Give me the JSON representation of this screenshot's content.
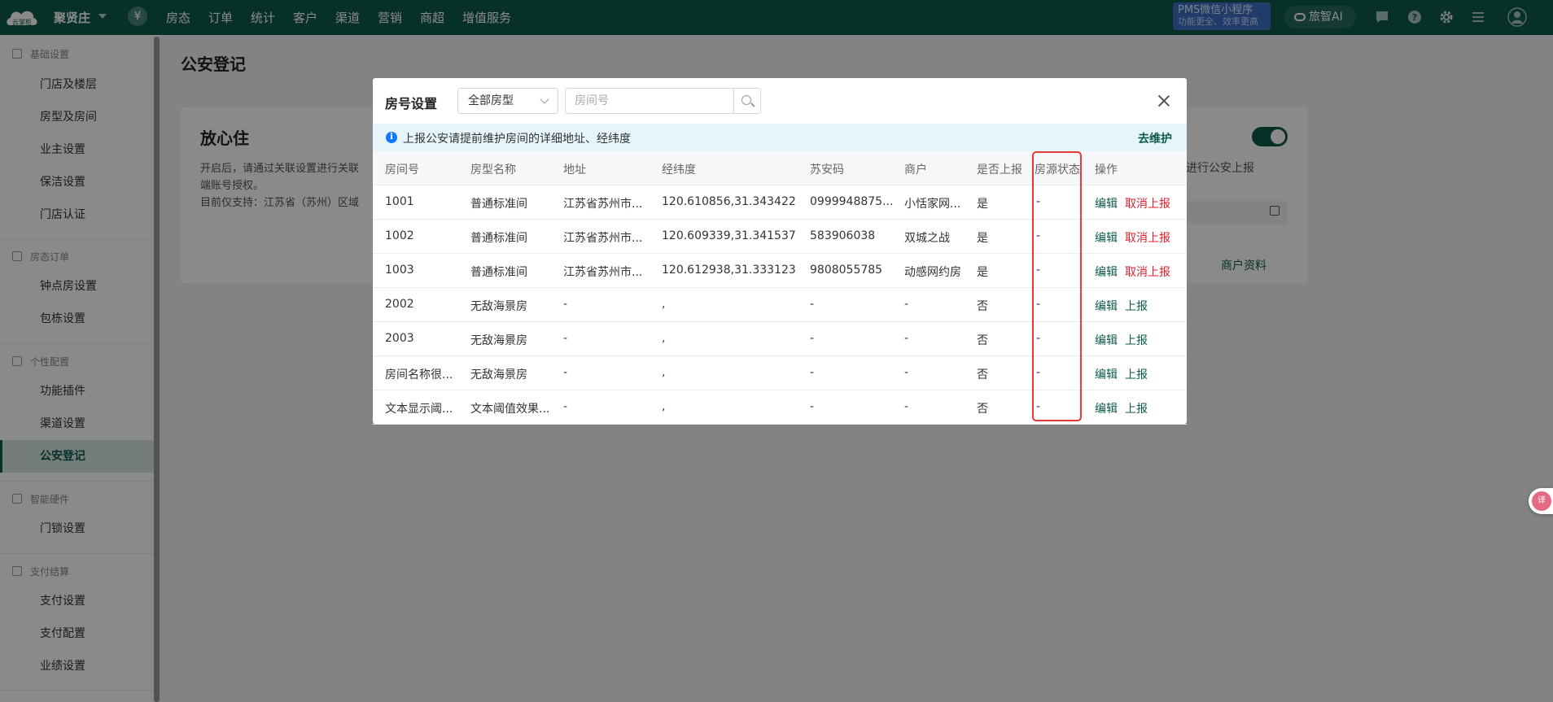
{
  "topbar": {
    "logo_text": "云掌柜",
    "store_name": "聚贤庄",
    "currency_icon": "¥",
    "nav": [
      "房态",
      "订单",
      "统计",
      "客户",
      "渠道",
      "营销",
      "商超",
      "增值服务"
    ],
    "pms_line1": "PMS微信小程序",
    "pms_line2": "功能更全、效率更高",
    "ai_label": "旅智AI",
    "colors": {
      "bar": "#0d5a4b",
      "pms": "#3e6fc4"
    }
  },
  "sidebar": {
    "groups": [
      {
        "label": "基础设置",
        "icon": "home-icon",
        "items": [
          "门店及楼层",
          "房型及房间",
          "业主设置",
          "保洁设置",
          "门店认证"
        ]
      },
      {
        "label": "房态订单",
        "icon": "calendar-icon",
        "items": [
          "钟点房设置",
          "包栋设置"
        ]
      },
      {
        "label": "个性配置",
        "icon": "config-icon",
        "items": [
          "功能插件",
          "渠道设置",
          "公安登记"
        ]
      },
      {
        "label": "智能硬件",
        "icon": "device-icon",
        "items": [
          "门锁设置"
        ]
      },
      {
        "label": "支付结算",
        "icon": "payment-icon",
        "items": [
          "支付设置",
          "支付配置",
          "业绩设置"
        ]
      }
    ],
    "active": "公安登记"
  },
  "page": {
    "title": "公安登记",
    "card_title": "放心住",
    "card_line1": "开启后，请通过关联设置进行关联",
    "card_line2": "端账号授权。",
    "card_line3": "目前仅支持：江苏省（苏州）区域",
    "right_text": "进行公安上报",
    "right_link": "商户资料"
  },
  "modal": {
    "title": "房号设置",
    "room_type_select": "全部房型",
    "search_placeholder": "房间号",
    "info_text": "上报公安请提前维护房间的详细地址、经纬度",
    "info_link": "去维护",
    "columns": [
      "房间号",
      "房型名称",
      "地址",
      "经纬度",
      "苏安码",
      "商户",
      "是否上报",
      "房源状态",
      "操作"
    ],
    "rows": [
      {
        "room": "1001",
        "type": "普通标准间",
        "address": "江苏省苏州市...",
        "coords": "120.610856,31.343422",
        "code": "0999948875...",
        "merchant": "小恬家网...",
        "reported": "是",
        "status": "-",
        "edit": "编辑",
        "action": "取消上报",
        "action_kind": "cancel"
      },
      {
        "room": "1002",
        "type": "普通标准间",
        "address": "江苏省苏州市...",
        "coords": "120.609339,31.341537",
        "code": "583906038",
        "merchant": "双城之战",
        "reported": "是",
        "status": "-",
        "edit": "编辑",
        "action": "取消上报",
        "action_kind": "cancel"
      },
      {
        "room": "1003",
        "type": "普通标准间",
        "address": "江苏省苏州市...",
        "coords": "120.612938,31.333123",
        "code": "9808055785",
        "merchant": "动感网约房",
        "reported": "是",
        "status": "-",
        "edit": "编辑",
        "action": "取消上报",
        "action_kind": "cancel"
      },
      {
        "room": "2002",
        "type": "无敌海景房",
        "address": "-",
        "coords": ",",
        "code": "-",
        "merchant": "-",
        "reported": "否",
        "status": "-",
        "edit": "编辑",
        "action": "上报",
        "action_kind": "report"
      },
      {
        "room": "2003",
        "type": "无敌海景房",
        "address": "-",
        "coords": ",",
        "code": "-",
        "merchant": "-",
        "reported": "否",
        "status": "-",
        "edit": "编辑",
        "action": "上报",
        "action_kind": "report"
      },
      {
        "room": "房间名称很...",
        "type": "无敌海景房",
        "address": "-",
        "coords": ",",
        "code": "-",
        "merchant": "-",
        "reported": "否",
        "status": "-",
        "edit": "编辑",
        "action": "上报",
        "action_kind": "report"
      },
      {
        "room": "文本显示阈...",
        "type": "文本阈值效果...",
        "address": "-",
        "coords": ",",
        "code": "-",
        "merchant": "-",
        "reported": "否",
        "status": "-",
        "edit": "编辑",
        "action": "上报",
        "action_kind": "report"
      }
    ],
    "colors": {
      "primary": "#0d5a4b",
      "danger": "#e0202e",
      "highlight": "#e53935"
    }
  },
  "float_widget_text": "译"
}
